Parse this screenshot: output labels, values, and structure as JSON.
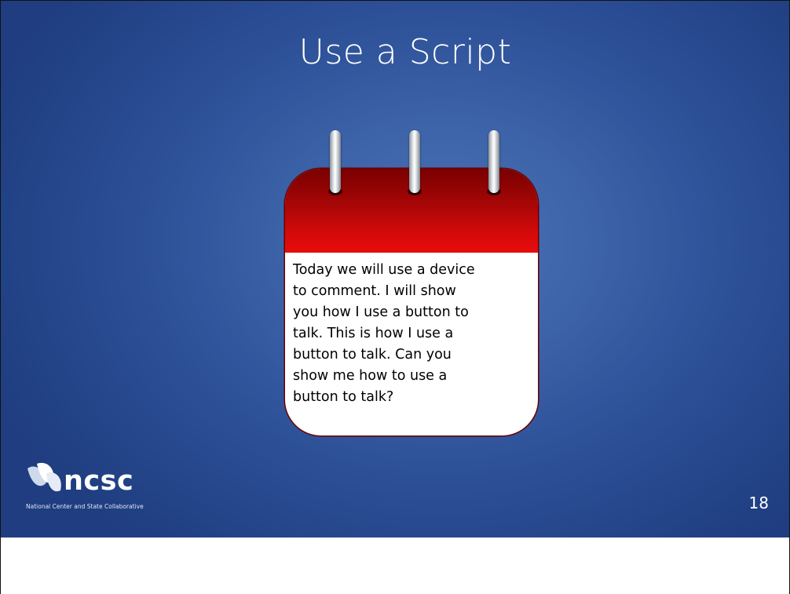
{
  "slide": {
    "title": "Use a Script",
    "background_color": "#2c4f96",
    "calendar": {
      "header_color": "#d80a0a",
      "lines": [
        "Today we will use a device",
        "to comment.  I will show",
        "you  how I use a button to",
        "talk. This is how I use a",
        "button to talk.  Can you",
        "show me  how to use a",
        "button to talk?"
      ]
    },
    "logo": {
      "name": "ncsc",
      "tagline": "National Center and State Collaborative"
    },
    "page_number": "18"
  }
}
